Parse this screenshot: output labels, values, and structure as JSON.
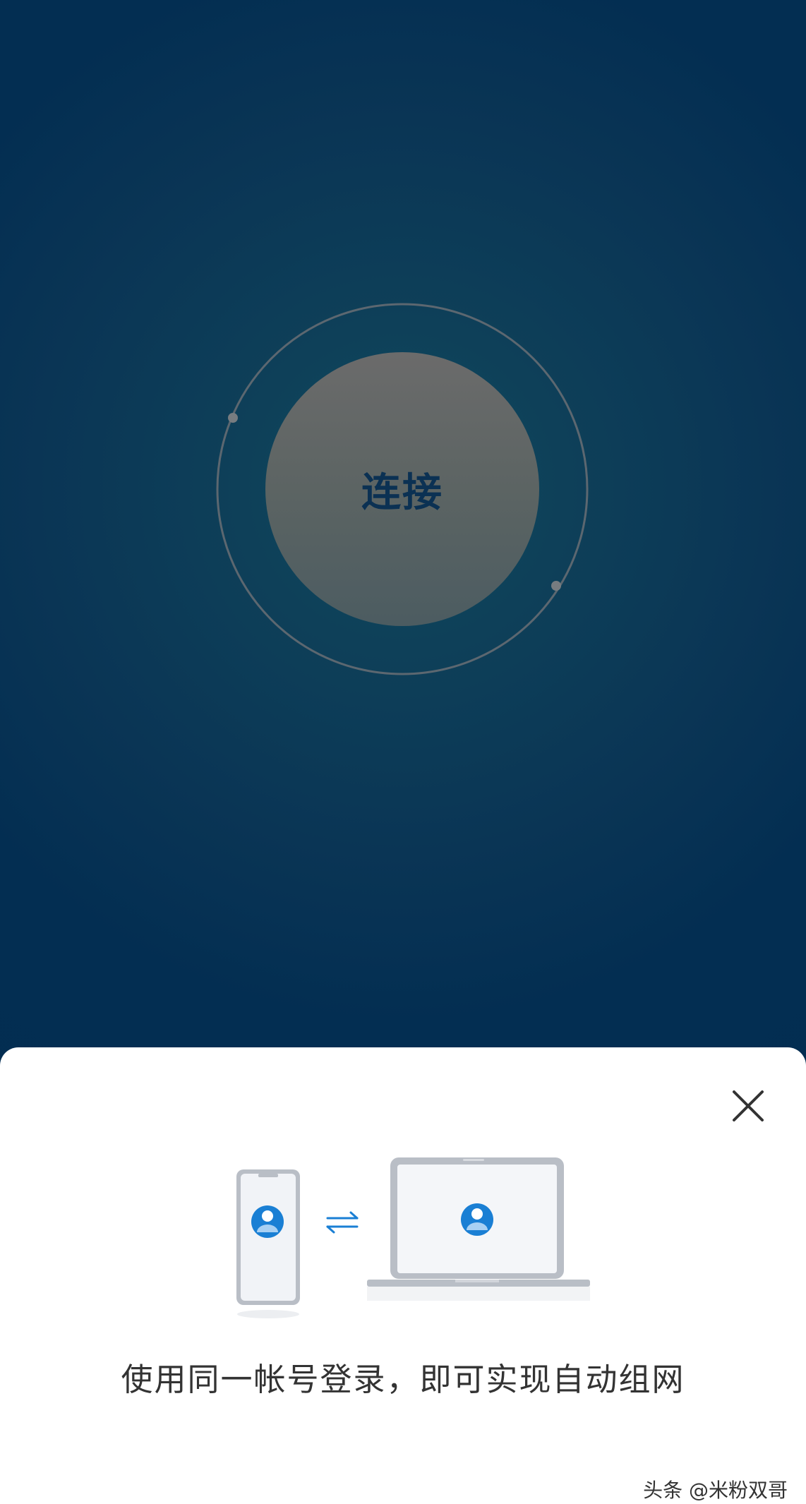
{
  "connect": {
    "label": "连接"
  },
  "sheet": {
    "message": "使用同一帐号登录，即可实现自动组网",
    "close_icon": "close-icon",
    "illustration_icons": [
      "phone-icon",
      "swap-arrows-icon",
      "laptop-icon",
      "user-avatar-icon"
    ]
  },
  "watermark": {
    "text": "头条 @米粉双哥"
  },
  "colors": {
    "background": "#032e52",
    "button_fill": "#636363",
    "button_text": "#0b3153",
    "accent_blue": "#1a7fd4",
    "sheet_background": "#ffffff"
  }
}
